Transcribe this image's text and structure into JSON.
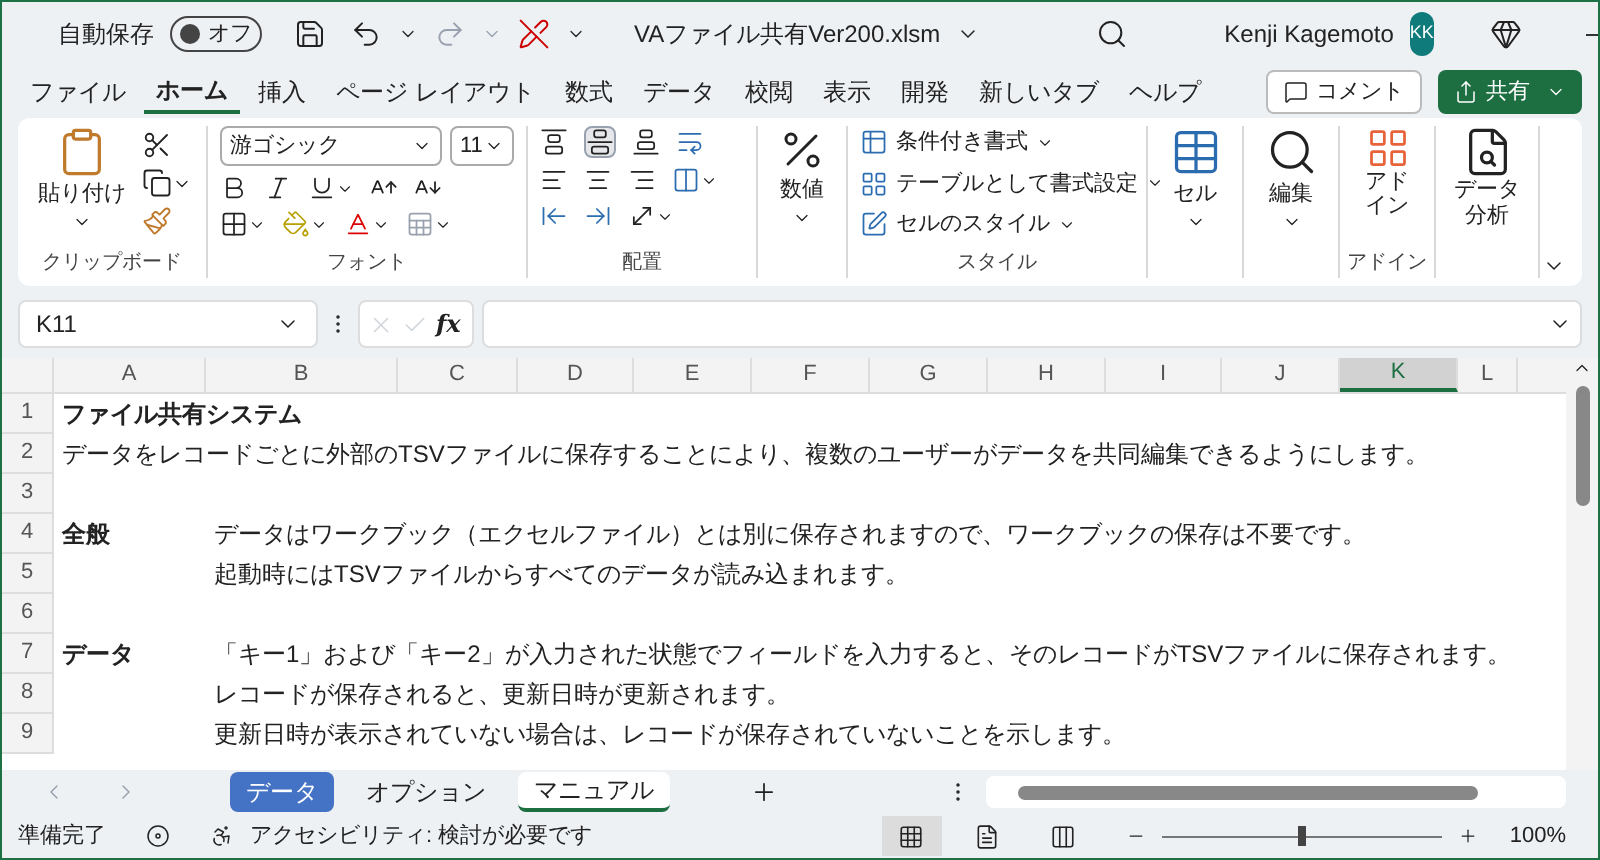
{
  "title_bar": {
    "autosave_label": "自動保存",
    "autosave_toggle": {
      "label": "オフ",
      "on": false
    },
    "filename": "VAファイル共有Ver200.xlsm",
    "user_name": "Kenji Kagemoto",
    "avatar_initials": "KK"
  },
  "ribbon_tabs": [
    {
      "label": "ファイル",
      "selected": false
    },
    {
      "label": "ホーム",
      "selected": true
    },
    {
      "label": "挿入",
      "selected": false
    },
    {
      "label": "ページ レイアウト",
      "selected": false
    },
    {
      "label": "数式",
      "selected": false
    },
    {
      "label": "データ",
      "selected": false
    },
    {
      "label": "校閲",
      "selected": false
    },
    {
      "label": "表示",
      "selected": false
    },
    {
      "label": "開発",
      "selected": false
    },
    {
      "label": "新しいタブ",
      "selected": false
    },
    {
      "label": "ヘルプ",
      "selected": false
    }
  ],
  "comment_button": "コメント",
  "share_button": "共有",
  "ribbon": {
    "clipboard": {
      "paste_label": "貼り付け",
      "name": "クリップボード"
    },
    "font": {
      "font_name": "游ゴシック",
      "font_size": "11",
      "name": "フォント"
    },
    "alignment": {
      "name": "配置"
    },
    "number": {
      "label": "数値"
    },
    "styles": {
      "items": [
        "条件付き書式",
        "テーブルとして書式設定",
        "セルのスタイル"
      ],
      "name": "スタイル"
    },
    "cells": {
      "label": "セル"
    },
    "editing": {
      "label": "編集"
    },
    "addins": {
      "lines": [
        "アド",
        "イン"
      ],
      "name": "アドイン"
    },
    "analysis": {
      "lines": [
        "データ",
        "分析"
      ]
    }
  },
  "formula_bar": {
    "name_box": "K11",
    "fx_label": "fx"
  },
  "columns": [
    {
      "label": "A",
      "selected": false
    },
    {
      "label": "B",
      "selected": false
    },
    {
      "label": "C",
      "selected": false
    },
    {
      "label": "D",
      "selected": false
    },
    {
      "label": "E",
      "selected": false
    },
    {
      "label": "F",
      "selected": false
    },
    {
      "label": "G",
      "selected": false
    },
    {
      "label": "H",
      "selected": false
    },
    {
      "label": "I",
      "selected": false
    },
    {
      "label": "J",
      "selected": false
    },
    {
      "label": "K",
      "selected": true
    },
    {
      "label": "L",
      "selected": false
    }
  ],
  "rows": [
    {
      "number": "1",
      "column_a": {
        "text": "ファイル共有システム",
        "bold": true
      }
    },
    {
      "number": "2",
      "column_a": {
        "text": "データをレコードごとに外部のTSVファイルに保存することにより、複数のユーザーがデータを共同編集できるようにします。",
        "bold": false
      }
    },
    {
      "number": "3"
    },
    {
      "number": "4",
      "column_a": {
        "text": "全般",
        "bold": true
      },
      "column_b": "データはワークブック（エクセルファイル）とは別に保存されますので、ワークブックの保存は不要です。"
    },
    {
      "number": "5",
      "column_b": "起動時にはTSVファイルからすべてのデータが読み込まれます。"
    },
    {
      "number": "6"
    },
    {
      "number": "7",
      "column_a": {
        "text": "データ",
        "bold": true
      },
      "column_b": "「キー1」および「キー2」が入力された状態でフィールドを入力すると、そのレコードがTSVファイルに保存されます。"
    },
    {
      "number": "8",
      "column_b": "レコードが保存されると、更新日時が更新されます。"
    },
    {
      "number": "9",
      "column_b": "更新日時が表示されていない場合は、レコードが保存されていないことを示します。"
    }
  ],
  "sheet_tabs": [
    {
      "label": "データ",
      "selected": false,
      "color": "#4472c4"
    },
    {
      "label": "オプション",
      "selected": false
    },
    {
      "label": "マニュアル",
      "selected": true
    }
  ],
  "status_bar": {
    "ready": "準備完了",
    "accessibility": "アクセシビリティ: 検討が必要です",
    "view_buttons": [
      {
        "kind": "normal",
        "selected": true
      },
      {
        "kind": "page_layout",
        "selected": false
      },
      {
        "kind": "page_break",
        "selected": false
      }
    ],
    "zoom": {
      "level": 0.5
    },
    "zoom_label": "100%"
  }
}
